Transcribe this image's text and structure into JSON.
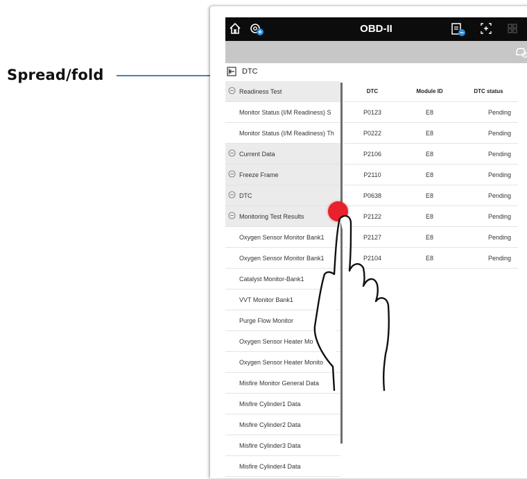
{
  "annotation": {
    "label": "Spread/fold"
  },
  "topbar": {
    "title": "OBD-II",
    "icons": [
      "home-icon",
      "vehicle-settings-icon",
      "vehicle-report-icon",
      "fullscreen-icon",
      "grid-icon"
    ]
  },
  "graybar": {
    "icon": "car-icon"
  },
  "header": {
    "label": "DTC",
    "fold_icon": "fold-icon"
  },
  "sidebar": {
    "items": [
      {
        "label": "Readiness Test",
        "type": "category"
      },
      {
        "label": "Monitor Status (I/M Readiness) S",
        "type": "item"
      },
      {
        "label": "Monitor Status (I/M Readiness) Th",
        "type": "item"
      },
      {
        "label": "Current Data",
        "type": "category"
      },
      {
        "label": "Freeze Frame",
        "type": "category"
      },
      {
        "label": "DTC",
        "type": "category"
      },
      {
        "label": "Monitoring Test Results",
        "type": "category"
      },
      {
        "label": "Oxygen Sensor Monitor Bank1",
        "type": "item"
      },
      {
        "label": "Oxygen Sensor Monitor Bank1",
        "type": "item"
      },
      {
        "label": "Catalyst Monitor-Bank1",
        "type": "item"
      },
      {
        "label": "VVT Monitor Bank1",
        "type": "item"
      },
      {
        "label": "Purge Flow Monitor",
        "type": "item"
      },
      {
        "label": "Oxygen Sensor Heater Mo",
        "type": "item"
      },
      {
        "label": "Oxygen Sensor Heater Monito",
        "type": "item"
      },
      {
        "label": "Misfire Monitor General Data",
        "type": "item"
      },
      {
        "label": "Misfire Cylinder1 Data",
        "type": "item"
      },
      {
        "label": "Misfire Cylinder2 Data",
        "type": "item"
      },
      {
        "label": "Misfire Cylinder3 Data",
        "type": "item"
      },
      {
        "label": "Misfire Cylinder4 Data",
        "type": "item"
      }
    ]
  },
  "table": {
    "columns": [
      "DTC",
      "Module ID",
      "DTC status"
    ],
    "rows": [
      [
        "P0123",
        "E8",
        "Pending"
      ],
      [
        "P0222",
        "E8",
        "Pending"
      ],
      [
        "P2106",
        "E8",
        "Pending"
      ],
      [
        "P2110",
        "E8",
        "Pending"
      ],
      [
        "P0638",
        "E8",
        "Pending"
      ],
      [
        "P2122",
        "E8",
        "Pending"
      ],
      [
        "P2127",
        "E8",
        "Pending"
      ],
      [
        "P2104",
        "E8",
        "Pending"
      ]
    ]
  },
  "colors": {
    "topbar": "#0c0c0c",
    "graybar": "#c7c7c7",
    "category_bg": "#ebebeb",
    "callout": "#4a7fc0",
    "touch_dot": "#e8212c"
  }
}
